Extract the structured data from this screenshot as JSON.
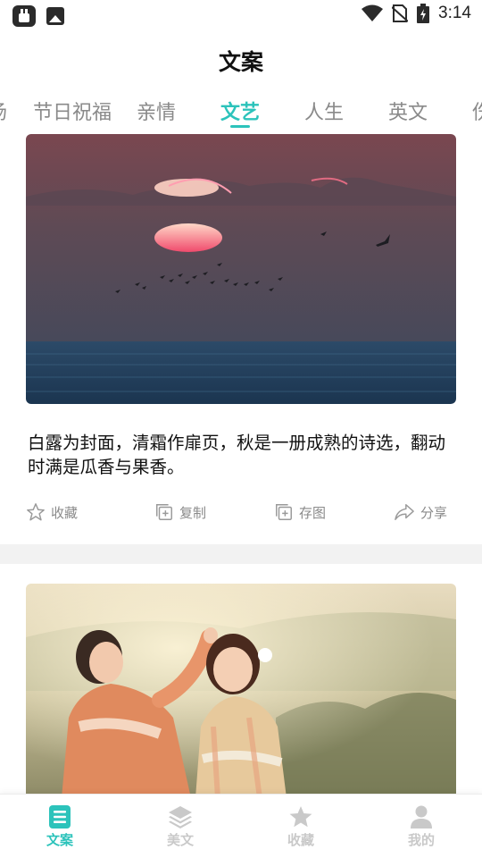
{
  "status_bar": {
    "time": "3:14"
  },
  "header": {
    "title": "文案"
  },
  "tabs": [
    "场",
    "节日祝福",
    "亲情",
    "文艺",
    "人生",
    "英文",
    "伤"
  ],
  "active_tab_index": 3,
  "colors": {
    "accent": "#2cc3bb",
    "inactive": "#8a8a8a",
    "nav_inactive": "#c9c9c9"
  },
  "card1": {
    "text": "白露为封面，清霜作扉页，秋是一册成熟的诗选，翻动时满是瓜香与果香。",
    "actions": [
      {
        "label": "收藏",
        "icon": "star-outline-icon"
      },
      {
        "label": "复制",
        "icon": "copy-icon"
      },
      {
        "label": "存图",
        "icon": "save-image-icon"
      },
      {
        "label": "分享",
        "icon": "share-icon"
      }
    ]
  },
  "nav": [
    {
      "label": "文案",
      "icon": "document-icon",
      "active": true
    },
    {
      "label": "美文",
      "icon": "layers-icon",
      "active": false
    },
    {
      "label": "收藏",
      "icon": "star-icon",
      "active": false
    },
    {
      "label": "我的",
      "icon": "person-icon",
      "active": false
    }
  ]
}
